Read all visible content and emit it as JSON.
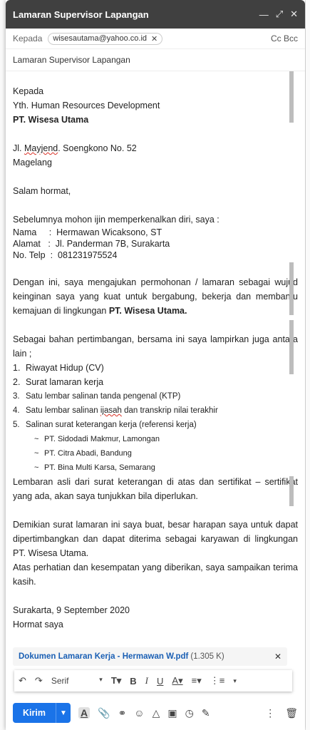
{
  "window": {
    "title": "Lamaran Supervisor Lapangan"
  },
  "to": {
    "label": "Kepada",
    "recipient": "wisesautama@yahoo.co.id",
    "cc_bcc": "Cc Bcc"
  },
  "subject": "Lamaran Supervisor Lapangan",
  "body": {
    "l1": "Kepada",
    "l2": "Yth. Human Resources Development",
    "l3": "PT. Wisesa Utama",
    "addr_a": "Jl. ",
    "addr_b": "Mayjend",
    "addr_c": ". Soengkono No. 52",
    "city": "Magelang",
    "greeting": "Salam hormat,",
    "intro": "Sebelumnya mohon ijin memperkenalkan diri, saya :",
    "id_lines": [
      "Nama     :  Hermawan Wicaksono, ST",
      "Alamat   :  Jl. Panderman 7B, Surakarta",
      "No. Telp  :  081231975524"
    ],
    "para1": "Dengan ini, saya mengajukan permohonan / lamaran sebagai wujud keinginan saya yang kuat untuk bergabung, bekerja dan membantu kemajuan di lingkungan ",
    "para1_bold": "PT. Wisesa Utama.",
    "para2": "Sebagai bahan pertimbangan, bersama ini saya lampirkan juga antara lain ;",
    "list": [
      {
        "n": "1.",
        "text": "Riwayat Hidup (CV)"
      },
      {
        "n": "2.",
        "text": "Surat lamaran kerja"
      },
      {
        "n": "3.",
        "text": "Satu lembar salinan tanda pengenal (KTP)"
      },
      {
        "n": "4.",
        "text_a": "Satu lembar salinan ",
        "text_b": "ijasah",
        "text_c": " dan transkrip nilai terakhir"
      },
      {
        "n": "5.",
        "text": "Salinan surat keterangan kerja (referensi kerja)"
      }
    ],
    "sublist": [
      "PT. Sidodadi Makmur, Lamongan",
      "PT. Citra Abadi, Bandung",
      "PT. Bina Multi Karsa, Semarang"
    ],
    "para3": "Lembaran asli dari surat keterangan di atas dan sertifikat – sertifikat yang ada, akan saya tunjukkan bila diperlukan.",
    "para4": "Demikian surat lamaran ini saya buat, besar harapan saya untuk dapat dipertimbangkan dan dapat diterima sebagai karyawan di lingkungan PT. Wisesa Utama.",
    "para5": "Atas perhatian dan kesempatan yang diberikan, saya sampaikan terima kasih.",
    "date": "Surakarta, 9 September 2020",
    "closing": "Hormat saya"
  },
  "attachment": {
    "name": "Dokumen Lamaran Kerja - Hermawan W.pdf",
    "size": "(1.305 K)"
  },
  "format_bar": {
    "font": "Serif"
  },
  "bottom": {
    "send": "Kirim"
  },
  "icons": [
    "minimize-icon",
    "expand-icon",
    "close-icon",
    "undo-icon",
    "redo-icon",
    "text-size-icon",
    "bold-icon",
    "italic-icon",
    "underline-icon",
    "text-color-icon",
    "align-icon",
    "numbered-list-icon",
    "more-icon",
    "formatting-icon",
    "attach-icon",
    "link-icon",
    "emoji-icon",
    "drive-icon",
    "photo-icon",
    "confidential-icon",
    "signature-icon",
    "more-options-icon",
    "trash-icon"
  ]
}
